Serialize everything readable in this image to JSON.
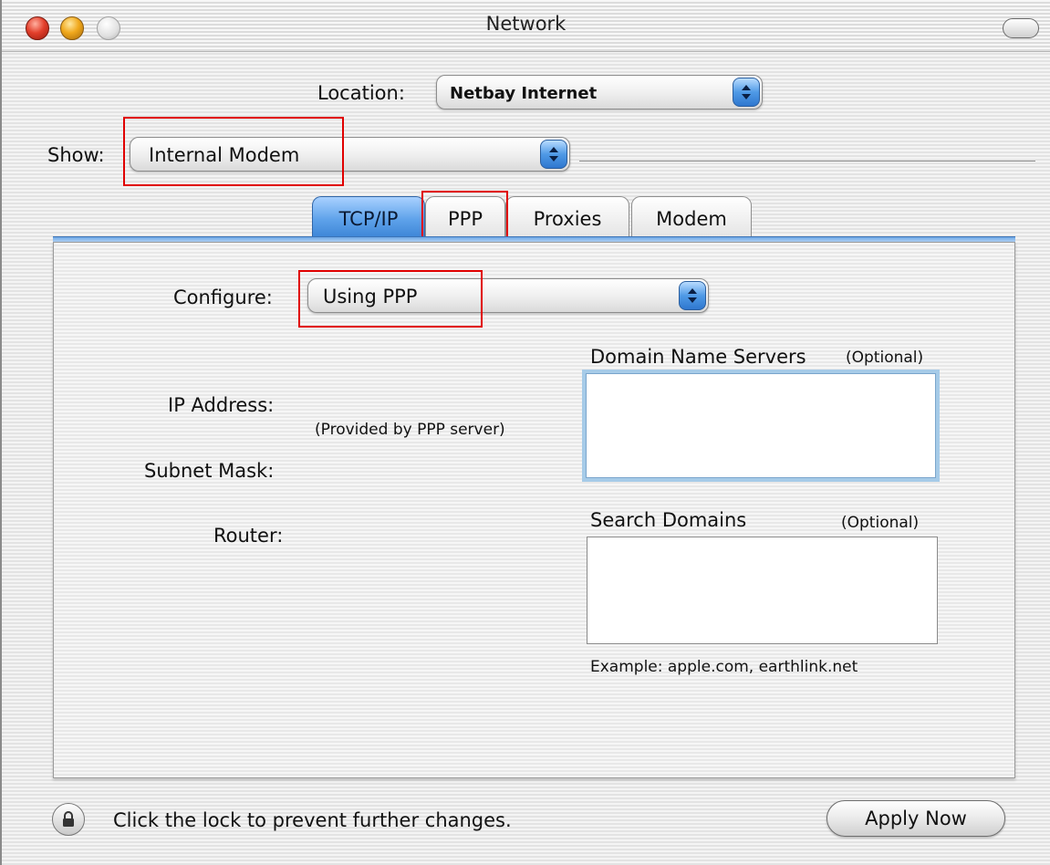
{
  "window": {
    "title": "Network"
  },
  "location": {
    "label": "Location:",
    "value": "Netbay Internet"
  },
  "show": {
    "label": "Show:",
    "value": "Internal Modem"
  },
  "tabs": [
    {
      "label": "TCP/IP",
      "active": true
    },
    {
      "label": "PPP",
      "active": false
    },
    {
      "label": "Proxies",
      "active": false
    },
    {
      "label": "Modem",
      "active": false
    }
  ],
  "panel": {
    "configure_label": "Configure:",
    "configure_value": "Using PPP",
    "ip_address_label": "IP Address:",
    "provided_note": "(Provided by PPP server)",
    "subnet_mask_label": "Subnet Mask:",
    "router_label": "Router:",
    "dns_label": "Domain Name Servers",
    "dns_optional": "(Optional)",
    "search_label": "Search Domains",
    "search_optional": "(Optional)",
    "example_text": "Example: apple.com, earthlink.net"
  },
  "footer": {
    "lock_text": "Click the lock to prevent further changes.",
    "apply_label": "Apply Now"
  },
  "icons": {
    "close": "close-button-icon",
    "minimize": "minimize-button-icon",
    "zoom": "zoom-button-icon",
    "toolbar": "toolbar-toggle-icon",
    "popup_arrows": "up-down-arrows-icon",
    "lock": "lock-icon"
  },
  "colors": {
    "highlight_box": "#e00000",
    "active_tab": "#5ea2ea",
    "close": "#e3402c",
    "minimize": "#f0a81c"
  }
}
